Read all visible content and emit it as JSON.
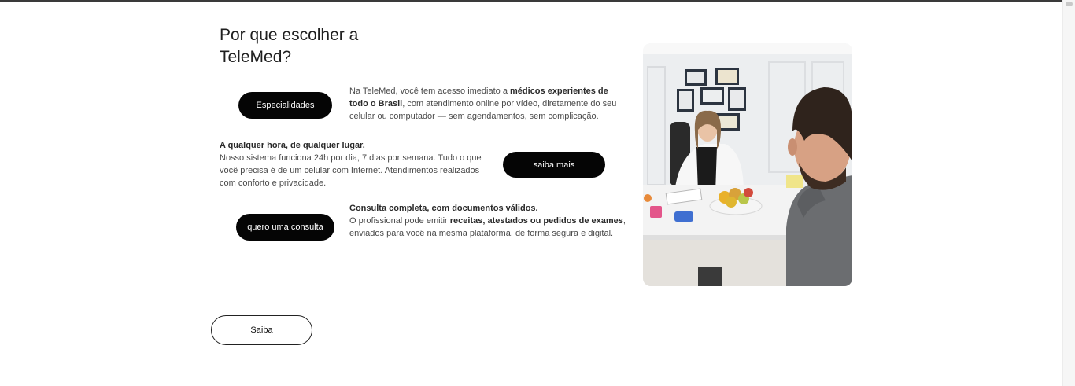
{
  "section": {
    "title": "Por que escolher a\nTeleMed?"
  },
  "buttons": {
    "specialties": "Especialidades",
    "learn_more": "saiba mais",
    "consult": "quero uma consulta",
    "saiba": "Saiba"
  },
  "features": {
    "access": {
      "t1": "Na TeleMed, você tem acesso imediato a ",
      "b1": "médicos experientes de todo o Brasil",
      "t2": ", com atendimento online por vídeo, diretamente do seu celular ou computador — sem agendamentos, sem complicação."
    },
    "anytime": {
      "heading": "A qualquer hora, de qualquer lugar.",
      "body": "Nosso sistema funciona 24h por dia, 7 dias por semana. Tudo o que você precisa é de um celular com Internet. Atendimentos realizados com conforto e privacidade."
    },
    "documents": {
      "heading": "Consulta completa, com documentos válidos.",
      "t1": "O profissional pode emitir ",
      "b1": "receitas, atestados ou pedidos de exames",
      "t2": ", enviados para você na mesma plataforma, de forma segura e digital."
    }
  },
  "image": {
    "colors": {
      "wall": "#eef0f2",
      "desk": "#f4f4f4",
      "coat": "#f7f7f7",
      "hoodie": "#6b6d70",
      "hair": "#3a2a20"
    }
  }
}
